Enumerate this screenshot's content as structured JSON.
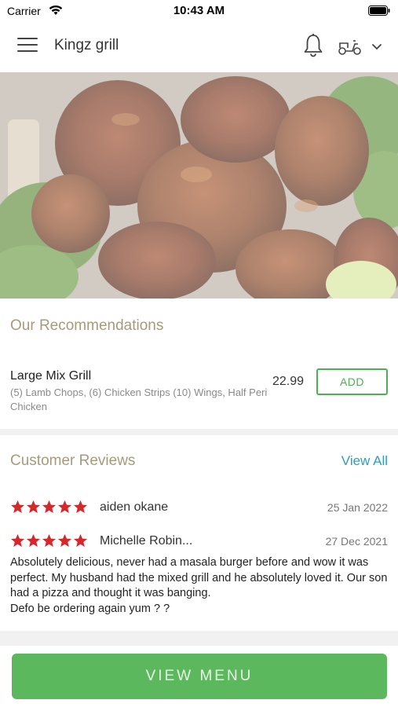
{
  "status_bar": {
    "carrier": "Carrier",
    "time": "10:43 AM"
  },
  "nav": {
    "title": "Kingz grill",
    "icons": [
      "menu-icon",
      "bell-icon",
      "scooter-icon",
      "chevron-down-icon"
    ]
  },
  "hero": {
    "image": "grilled chicken pieces with cilantro and lime"
  },
  "recommendations": {
    "title": "Our Recommendations",
    "items": [
      {
        "name": "Large Mix Grill",
        "description": "(5) Lamb Chops, (6) Chicken Strips (10) Wings, Half Peri Chicken",
        "price": "22.99",
        "add_label": "ADD"
      }
    ]
  },
  "reviews": {
    "title": "Customer Reviews",
    "view_all_label": "View All",
    "items": [
      {
        "name": "aiden okane",
        "date": "25 Jan 2022",
        "rating": 5
      },
      {
        "name": "Michelle Robin...",
        "date": "27 Dec 2021",
        "rating": 5,
        "text": "Absolutely delicious, never had a masala burger before and wow it was perfect. My husband had the mixed grill and he absolutely loved it. Our son had a pizza and thought it was banging.\nDefo be ordering again yum ? ?"
      }
    ]
  },
  "footer": {
    "view_menu_label": "VIEW MENU"
  },
  "colors": {
    "accent_green": "#5cb85c",
    "section_title": "#a59b7c",
    "link_blue": "#2c9ec0",
    "star_red": "#d6282a"
  }
}
